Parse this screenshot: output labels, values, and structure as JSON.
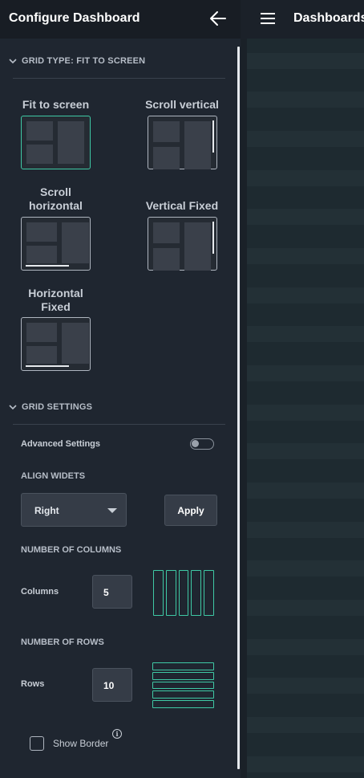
{
  "header": {
    "panel_title": "Configure Dashboard",
    "app_title": "Dashboards"
  },
  "grid_type": {
    "section_title": "GRID TYPE: FIT TO SCREEN",
    "options": [
      {
        "label": "Fit to screen",
        "selected": true,
        "scroll": "none"
      },
      {
        "label": "Scroll vertical",
        "selected": false,
        "scroll": "vertical"
      },
      {
        "label": "Scroll horizontal",
        "selected": false,
        "scroll": "horizontal"
      },
      {
        "label": "Vertical Fixed",
        "selected": false,
        "scroll": "vertical"
      },
      {
        "label": "Horizontal Fixed",
        "selected": false,
        "scroll": "horizontal"
      }
    ]
  },
  "grid_settings": {
    "section_title": "GRID SETTINGS",
    "advanced_settings_label": "Advanced Settings",
    "advanced_settings_on": false,
    "align_widgets_label": "ALIGN WIDETS",
    "align_value": "Right",
    "apply_label": "Apply",
    "columns_section": "NUMBER OF COLUMNS",
    "columns_label": "Columns",
    "columns_value": "5",
    "rows_section": "NUMBER OF ROWS",
    "rows_label": "Rows",
    "rows_value": "10",
    "show_border_label": "Show Border",
    "show_border_checked": false
  },
  "colors": {
    "accent": "#3fc9a5",
    "panel_bg": "#1f2630",
    "topbar_bg": "#181d24"
  }
}
